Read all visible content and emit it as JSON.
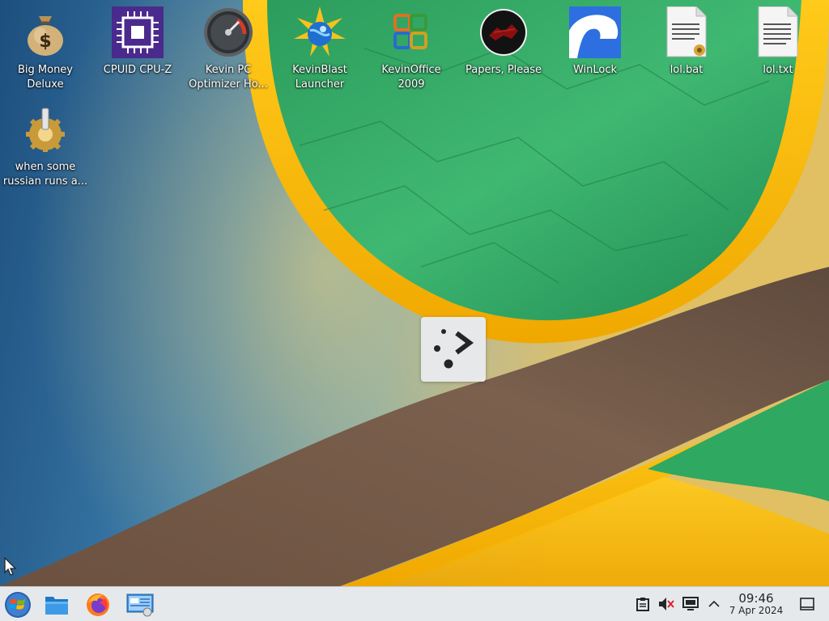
{
  "desktop": {
    "icons": [
      {
        "label": "Big Money\nDeluxe",
        "icon": "money-bag-icon"
      },
      {
        "label": "CPUID CPU-Z",
        "icon": "cpu-chip-icon"
      },
      {
        "label": "Kevin PC\nOptimizer Ho...",
        "icon": "speedometer-icon"
      },
      {
        "label": "KevinBlast\nLauncher",
        "icon": "globe-burst-icon"
      },
      {
        "label": "KevinOffice\n2009",
        "icon": "office-logo-icon"
      },
      {
        "label": "Papers, Please",
        "icon": "papers-please-seal-icon"
      },
      {
        "label": "WinLock",
        "icon": "winlock-icon"
      },
      {
        "label": "lol.bat",
        "icon": "batch-file-icon"
      },
      {
        "label": "lol.txt",
        "icon": "text-file-icon"
      },
      {
        "label": "when some\nrussian runs a...",
        "icon": "gear-script-icon"
      }
    ]
  },
  "taskbar": {
    "start": {
      "icon": "start-orb-icon"
    },
    "pinned": [
      {
        "icon": "file-manager-icon"
      },
      {
        "icon": "firefox-icon"
      },
      {
        "icon": "remote-desktop-icon"
      }
    ],
    "tray": [
      {
        "icon": "clipboard-icon"
      },
      {
        "icon": "speaker-muted-icon"
      },
      {
        "icon": "display-icon"
      },
      {
        "icon": "chevron-up-icon"
      }
    ],
    "clock": {
      "time": "09:46",
      "date": "7 Apr 2024"
    },
    "show_desktop": {
      "icon": "show-desktop-icon"
    }
  },
  "colors": {
    "taskbar_bg": "#e6e9ec",
    "wallpaper_green": "#2fa862",
    "wallpaper_gold": "#f5b800",
    "wallpaper_brown": "#6b5747",
    "wallpaper_blue": "#2b6a9c"
  }
}
